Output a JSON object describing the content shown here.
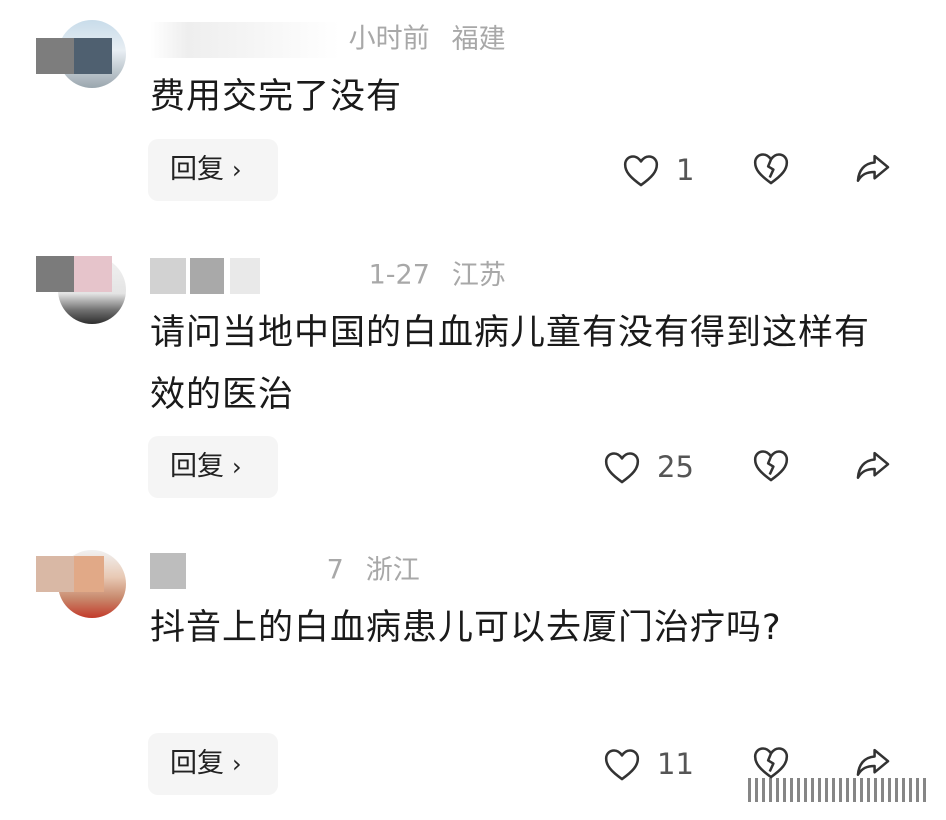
{
  "comments": [
    {
      "time": "小时前",
      "location": "福建",
      "text": "费用交完了没有",
      "reply_label": "回复",
      "likes": "1"
    },
    {
      "time": "1-27",
      "location": "江苏",
      "text": "请问当地中国的白血病儿童有没有得到这样有效的医治",
      "reply_label": "回复",
      "likes": "25"
    },
    {
      "time": "7",
      "location": "浙江",
      "text": "抖音上的白血病患儿可以去厦门治疗吗?",
      "reply_label": "回复",
      "likes": "11"
    }
  ],
  "icons": {
    "like": "heart-outline-icon",
    "dislike": "broken-heart-icon",
    "share": "share-arrow-icon",
    "reply_chevron": "chevron-right-icon"
  },
  "colors": {
    "meta_text": "#a8a8a8",
    "reply_bg": "#f5f5f5",
    "icon_stroke": "#333333"
  }
}
